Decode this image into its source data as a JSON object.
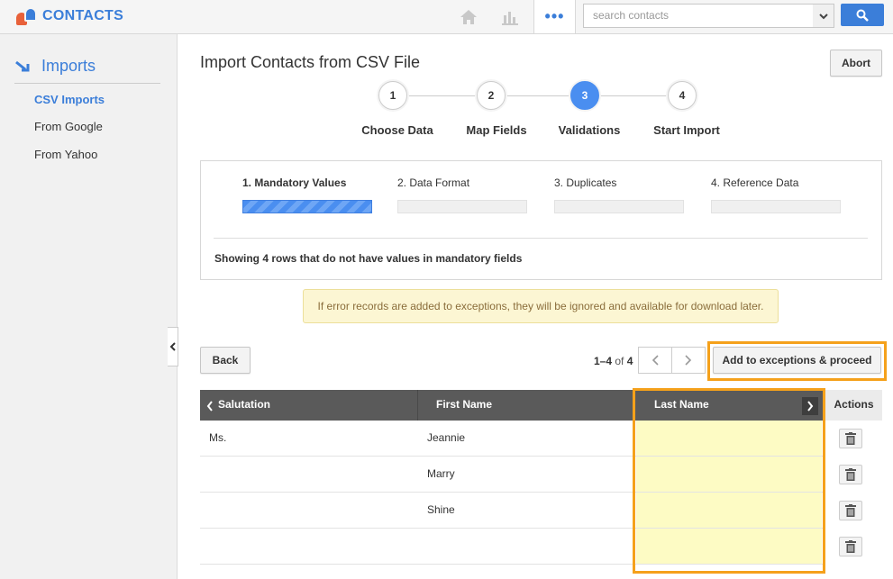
{
  "app": {
    "logo_text": "CONTACTS"
  },
  "header": {
    "search_placeholder": "search contacts",
    "more_label": "•••"
  },
  "sidebar": {
    "title": "Imports",
    "items": [
      {
        "label": "CSV Imports",
        "active": true
      },
      {
        "label": "From Google",
        "active": false
      },
      {
        "label": "From Yahoo",
        "active": false
      }
    ]
  },
  "page": {
    "title": "Import Contacts from CSV File",
    "abort_label": "Abort"
  },
  "wizard": {
    "steps": [
      {
        "number": "1",
        "label": "Choose Data"
      },
      {
        "number": "2",
        "label": "Map Fields"
      },
      {
        "number": "3",
        "label": "Validations"
      },
      {
        "number": "4",
        "label": "Start Import"
      }
    ],
    "active_step": 3
  },
  "validation": {
    "tabs": [
      {
        "label": "1. Mandatory Values"
      },
      {
        "label": "2. Data Format"
      },
      {
        "label": "3. Duplicates"
      },
      {
        "label": "4. Reference Data"
      }
    ],
    "active_tab": 1,
    "message": "Showing 4 rows that do not have values in mandatory fields"
  },
  "notice": "If error records are added to exceptions, they will be ignored and available for download later.",
  "controls": {
    "back_label": "Back",
    "pager_range": "1–4",
    "pager_of": "of",
    "pager_total": "4",
    "proceed_label": "Add to exceptions & proceed"
  },
  "table": {
    "columns": [
      "Salutation",
      "First Name",
      "Last Name",
      "Actions"
    ],
    "rows": [
      {
        "salutation": "Ms.",
        "first_name": "Jeannie",
        "last_name": ""
      },
      {
        "salutation": "",
        "first_name": "Marry",
        "last_name": ""
      },
      {
        "salutation": "",
        "first_name": "Shine",
        "last_name": ""
      },
      {
        "salutation": "",
        "first_name": "",
        "last_name": ""
      }
    ]
  },
  "colors": {
    "brand": "#3b7ed9",
    "highlight": "#f5a11b",
    "missing_value_fill": "#fdfbc4"
  }
}
